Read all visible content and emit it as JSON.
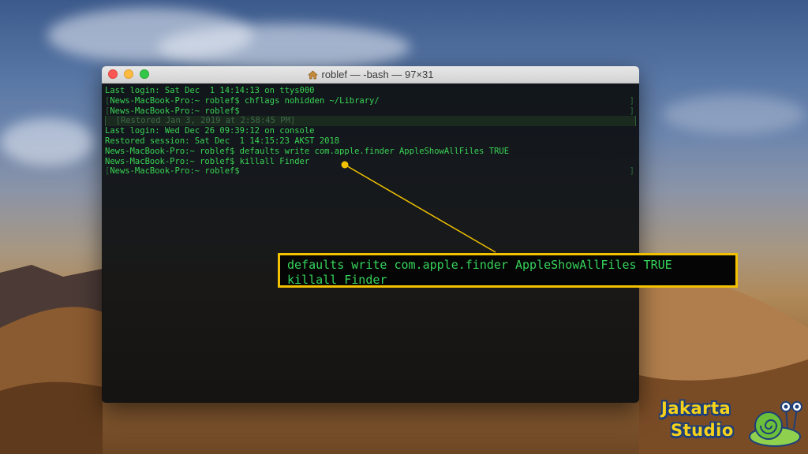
{
  "window": {
    "title": "roblef — -bash — 97×31",
    "icon": "home-icon"
  },
  "terminal_lines": [
    {
      "text": "Last login: Sat Dec  1 14:14:13 on ttys000",
      "bracket": false,
      "restored": false
    },
    {
      "text": "News-MacBook-Pro:~ roblef$ chflags nohidden ~/Library/",
      "bracket": true,
      "restored": false
    },
    {
      "text": "News-MacBook-Pro:~ roblef$",
      "bracket": true,
      "restored": false
    },
    {
      "text": "  [Restored Jan 3, 2019 at 2:58:45 PM]",
      "bracket": true,
      "restored": true
    },
    {
      "text": "Last login: Wed Dec 26 09:39:12 on console",
      "bracket": false,
      "restored": false
    },
    {
      "text": "Restored session: Sat Dec  1 14:15:23 AKST 2018",
      "bracket": false,
      "restored": false
    },
    {
      "text": "News-MacBook-Pro:~ roblef$ defaults write com.apple.finder AppleShowAllFiles TRUE",
      "bracket": false,
      "restored": false
    },
    {
      "text": "News-MacBook-Pro:~ roblef$ killall Finder",
      "bracket": false,
      "restored": false
    },
    {
      "text": "News-MacBook-Pro:~ roblef$",
      "bracket": true,
      "restored": false
    }
  ],
  "callout": {
    "line1": "defaults write com.apple.finder AppleShowAllFiles TRUE",
    "line2": "killall Finder",
    "border_color": "#f2c200"
  },
  "logo": {
    "line1": "Jakarta",
    "line2": "Studio"
  },
  "colors": {
    "terminal_text": "#39d353",
    "callout_accent": "#f2c200"
  }
}
